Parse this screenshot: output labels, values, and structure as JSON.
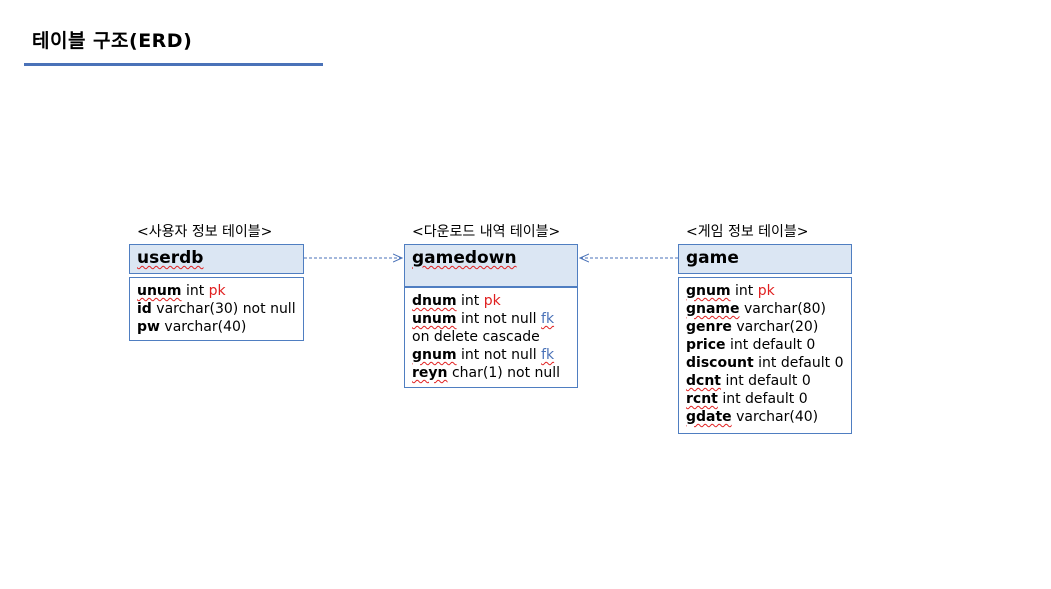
{
  "title": "테이블 구조(ERD)",
  "colors": {
    "accent": "#4a72b8",
    "header_fill": "#dbe6f3",
    "pk": "#e02020",
    "fk": "#4a72b8"
  },
  "tables": [
    {
      "caption": "<사용자 정보 테이블>",
      "name": "userdb",
      "fields": [
        {
          "name": "unum",
          "type": "int",
          "key": "pk"
        },
        {
          "name": "id",
          "type": "varchar(30) not null",
          "key": ""
        },
        {
          "name": "pw",
          "type": "varchar(40)",
          "key": ""
        }
      ]
    },
    {
      "caption": "<다운로드 내역 테이블>",
      "name": "gamedown",
      "fields": [
        {
          "name": "dnum",
          "type": "int",
          "key": "pk"
        },
        {
          "name": "unum",
          "type": "int not null",
          "key": "fk"
        },
        {
          "name": "",
          "type": "on delete cascade",
          "key": ""
        },
        {
          "name": "gnum",
          "type": "int not null",
          "key": "fk"
        },
        {
          "name": "reyn",
          "type": "char(1) not null",
          "key": ""
        }
      ]
    },
    {
      "caption": "<게임 정보 테이블>",
      "name": "game",
      "fields": [
        {
          "name": "gnum",
          "type": "int",
          "key": "pk"
        },
        {
          "name": "gname",
          "type": "varchar(80)",
          "key": ""
        },
        {
          "name": "genre",
          "type": "varchar(20)",
          "key": ""
        },
        {
          "name": "price",
          "type": "int default 0",
          "key": ""
        },
        {
          "name": "discount",
          "type": "int default 0",
          "key": ""
        },
        {
          "name": "dcnt",
          "type": "int default 0",
          "key": ""
        },
        {
          "name": "rcnt",
          "type": "int default 0",
          "key": ""
        },
        {
          "name": "gdate",
          "type": "varchar(40)",
          "key": ""
        }
      ]
    }
  ]
}
